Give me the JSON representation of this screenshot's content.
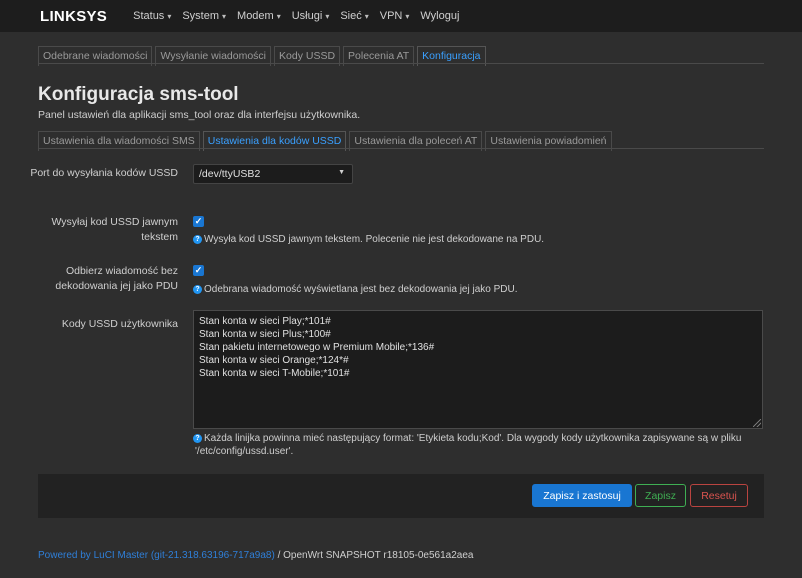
{
  "brand": "LINKSYS",
  "nav": [
    {
      "label": "Status",
      "dropdown": true
    },
    {
      "label": "System",
      "dropdown": true
    },
    {
      "label": "Modem",
      "dropdown": true
    },
    {
      "label": "Usługi",
      "dropdown": true
    },
    {
      "label": "Sieć",
      "dropdown": true
    },
    {
      "label": "VPN",
      "dropdown": true
    },
    {
      "label": "Wyloguj",
      "dropdown": false
    }
  ],
  "top_tabs": [
    {
      "label": "Odebrane wiadomości",
      "active": false
    },
    {
      "label": "Wysyłanie wiadomości",
      "active": false
    },
    {
      "label": "Kody USSD",
      "active": false
    },
    {
      "label": "Polecenia AT",
      "active": false
    },
    {
      "label": "Konfiguracja",
      "active": true
    }
  ],
  "page": {
    "title": "Konfiguracja sms-tool",
    "description": "Panel ustawień dla aplikacji sms_tool oraz dla interfejsu użytkownika."
  },
  "sub_tabs": [
    {
      "label": "Ustawienia dla wiadomości SMS",
      "active": false
    },
    {
      "label": "Ustawienia dla kodów USSD",
      "active": true
    },
    {
      "label": "Ustawienia dla poleceń AT",
      "active": false
    },
    {
      "label": "Ustawienia powiadomień",
      "active": false
    }
  ],
  "form": {
    "port": {
      "label": "Port do wysyłania kodów USSD",
      "value": "/dev/ttyUSB2"
    },
    "plain_text": {
      "label": "Wysyłaj kod USSD jawnym tekstem",
      "checked": true,
      "hint": "Wysyła kod USSD jawnym tekstem. Polecenie nie jest dekodowane na PDU."
    },
    "no_decode": {
      "label": "Odbierz wiadomość bez dekodowania jej jako PDU",
      "checked": true,
      "hint": "Odebrana wiadomość wyświetlana jest bez dekodowania jej jako PDU."
    },
    "user_codes": {
      "label": "Kody USSD użytkownika",
      "lines": [
        "Stan konta w sieci Play;*101#",
        "Stan konta w sieci Plus;*100#",
        "Stan pakietu internetowego w Premium Mobile;*136#",
        "Stan konta w sieci Orange;*124*#",
        "Stan konta w sieci T-Mobile;*101#"
      ],
      "hint_line1": "Każda linijka powinna mieć następujący format: 'Etykieta kodu;Kod'. Dla wygody kody użytkownika zapisywane są w pliku",
      "hint_line2": "'/etc/config/ussd.user'."
    }
  },
  "buttons": {
    "apply": "Zapisz i zastosuj",
    "save": "Zapisz",
    "reset": "Resetuj"
  },
  "footer": {
    "link": "Powered by LuCI Master (git-21.318.63196-717a9a8)",
    "text": " / OpenWrt SNAPSHOT r18105-0e561a2aea"
  },
  "colors": {
    "accent": "#1976d2",
    "link": "#3aa0ff",
    "save": "#3fae53",
    "reset": "#d9534f"
  }
}
